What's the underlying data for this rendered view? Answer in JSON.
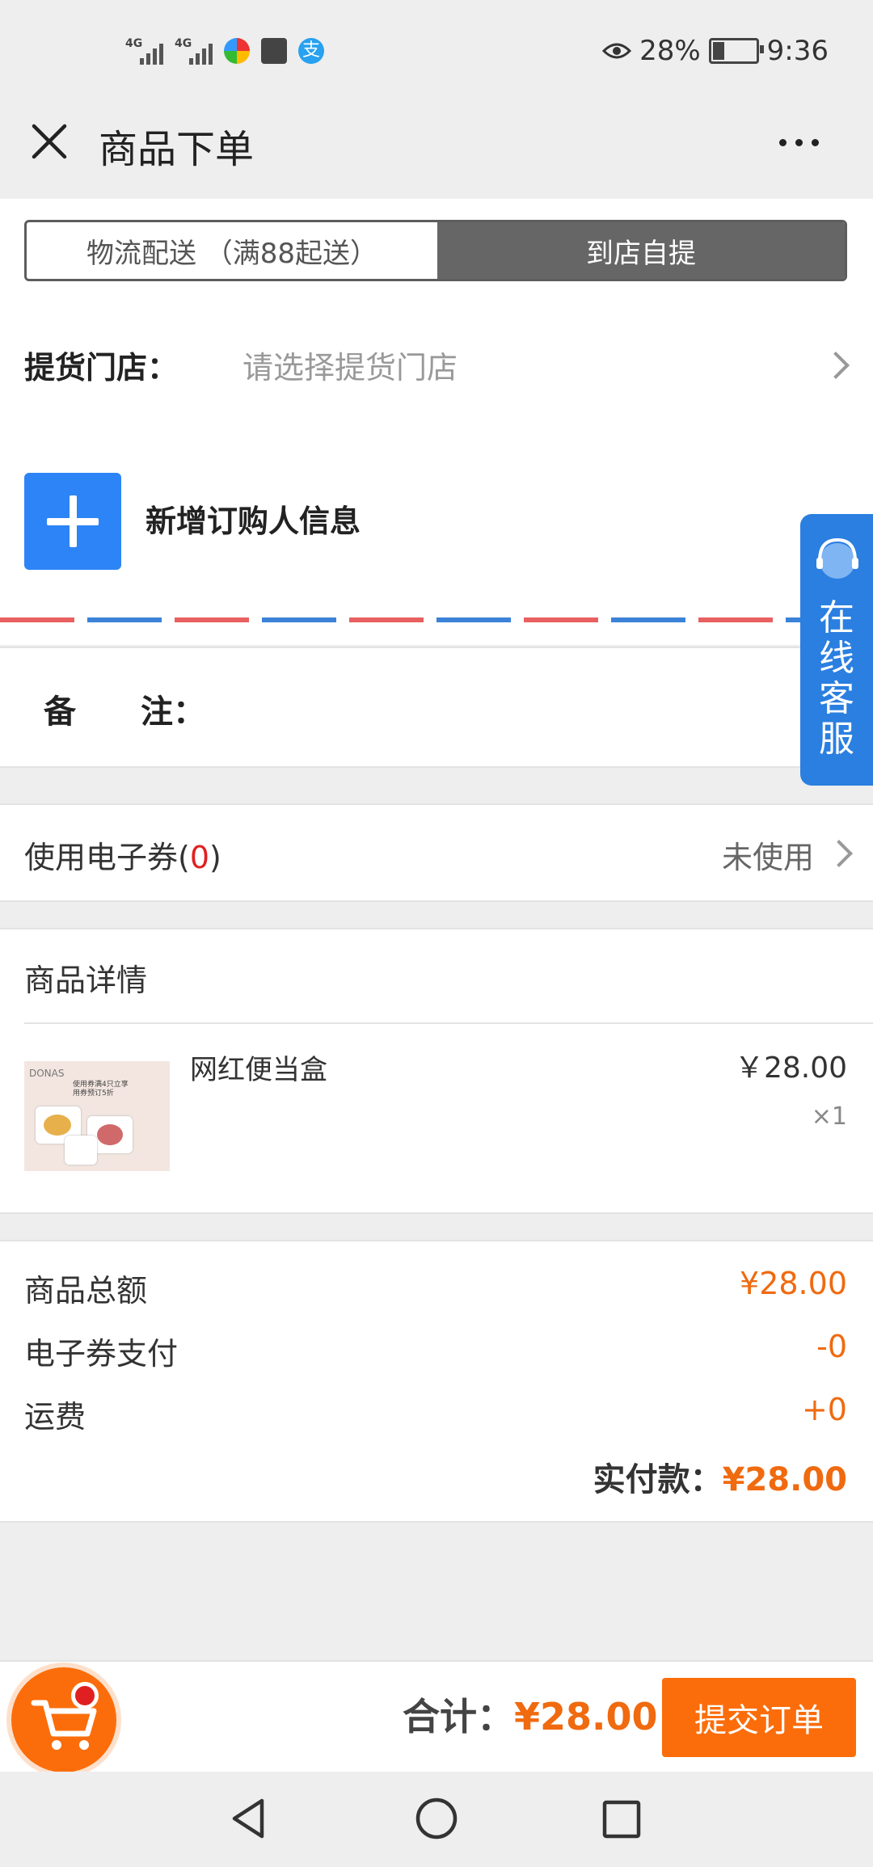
{
  "status_bar": {
    "net1": "4G",
    "net2": "4G",
    "battery_pct": "28%",
    "time": "9:36"
  },
  "header": {
    "title": "商品下单"
  },
  "delivery_tabs": [
    {
      "label": "物流配送 （满88起送）",
      "selected": false
    },
    {
      "label": "到店自提",
      "selected": true
    }
  ],
  "store": {
    "label": "提货门店：",
    "placeholder": "请选择提货门店"
  },
  "buyer": {
    "label": "新增订购人信息"
  },
  "remark": {
    "label": "备　　注："
  },
  "customer_service": {
    "label": "在线客服"
  },
  "coupon": {
    "label_prefix": "使用电子券(",
    "count": "0",
    "label_suffix": ")",
    "status": "未使用"
  },
  "product_section": {
    "title": "商品详情"
  },
  "product": {
    "name": "网红便当盒",
    "price": "￥28.00",
    "qty": "×1",
    "image_text": "DONAS",
    "image_promo": "使用券满4只立享 用券预订5折"
  },
  "summary": {
    "rows": [
      {
        "label": "商品总额",
        "value": "¥28.00"
      },
      {
        "label": "电子券支付",
        "value": "-0"
      },
      {
        "label": "运费",
        "value": "+0"
      }
    ],
    "actual_label": "实付款：",
    "actual_value": "¥28.00"
  },
  "footer": {
    "total_label": "合计：",
    "total_value": "¥28.00",
    "submit_label": "提交订单"
  },
  "colors": {
    "accent": "#fb6d0a",
    "blue": "#2d84f6",
    "red": "#e02020"
  }
}
